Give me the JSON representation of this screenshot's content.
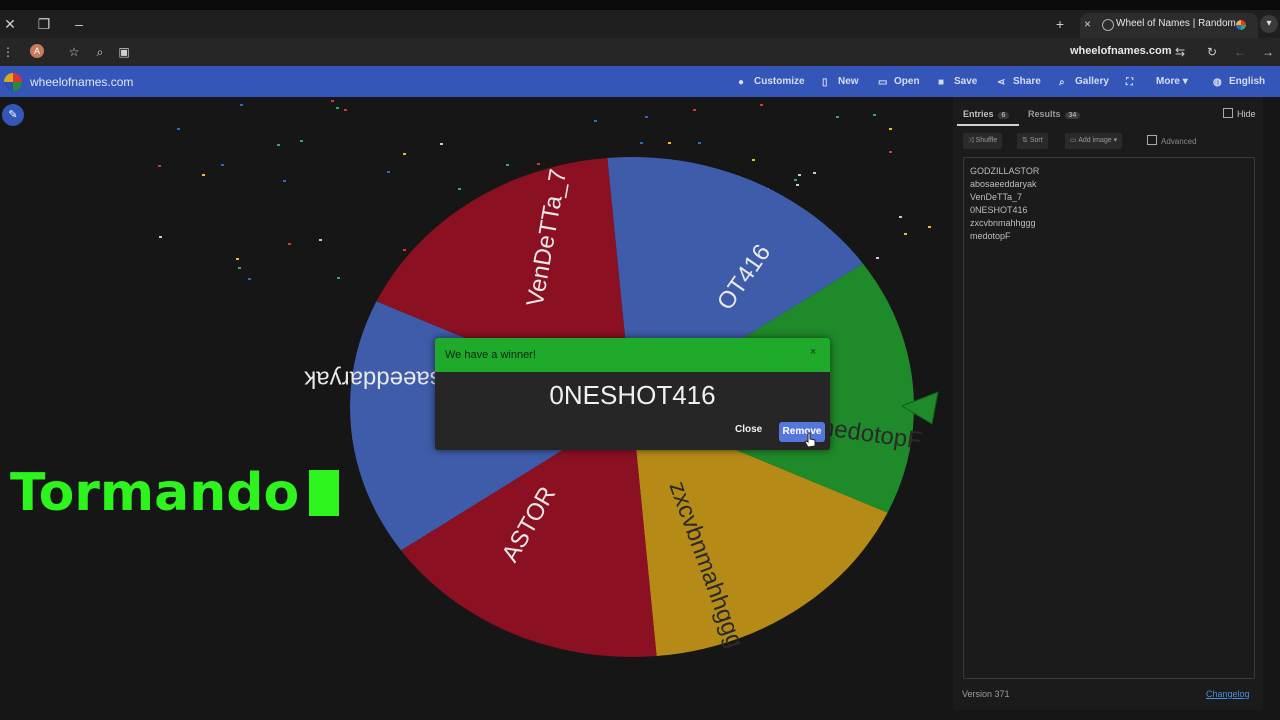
{
  "browser": {
    "tab_title": "Wheel of Names | Random",
    "url": "wheelofnames.com",
    "tab_close": "×",
    "new_tab": "+",
    "win_close": "✕",
    "win_restore": "❐",
    "win_min": "–",
    "profile_initial": "A"
  },
  "site": {
    "name": "wheelofnames.com",
    "menu": [
      "Customize",
      "New",
      "Open",
      "Save",
      "Share",
      "Gallery",
      "More",
      "English"
    ]
  },
  "wheel": {
    "segments": [
      {
        "label": "0NESHOT416",
        "color": "#1f8a2a"
      },
      {
        "label": "VenDeTTa_7",
        "color": "#b58a17"
      },
      {
        "label": "abosaeeddaryak",
        "color": "#8a1022"
      },
      {
        "label": "GODZILLASTOR",
        "color": "#3f5caa"
      },
      {
        "label": "medotopF",
        "color": "#8a1022"
      },
      {
        "label": "zxcvbnmahhggg",
        "color": "#3f5caa"
      }
    ],
    "visible_labels": [
      "medotopF",
      "zxcvbnmahhggg",
      "ASTOR",
      "abosaeeddaryak",
      "VenDeTTa_7",
      "OT416"
    ]
  },
  "overlay": {
    "text": "Tormando"
  },
  "modal": {
    "title": "We have a winner!",
    "close_x": "×",
    "winner": "0NESHOT416",
    "close_label": "Close",
    "remove_label": "Remove"
  },
  "panel": {
    "tabs": [
      {
        "label": "Entries",
        "count": "6"
      },
      {
        "label": "Results",
        "count": "34"
      }
    ],
    "hide_label": "Hide",
    "tools": [
      "Shuffle",
      "Sort",
      "Add image"
    ],
    "advanced_label": "Advanced",
    "entries": [
      "GODZILLASTOR",
      "abosaeeddaryak",
      "VenDeTTa_7",
      "0NESHOT416",
      "zxcvbnmahhggg",
      "medotopF"
    ],
    "version": "Version 371",
    "changelog": "Changelog"
  },
  "colors": {
    "site_bar": "#3456b8",
    "modal_header": "#1faa2c",
    "remove_button": "#5577dd",
    "overlay_text": "#2ef41e"
  }
}
